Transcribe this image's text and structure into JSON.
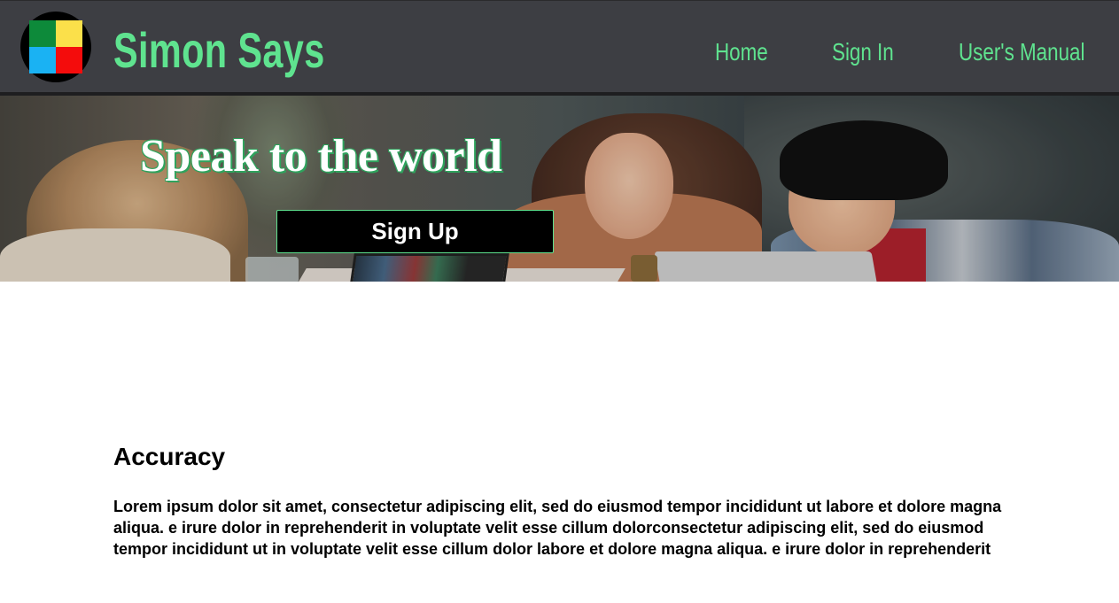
{
  "header": {
    "brand": "Simon Says",
    "logo_icon": "simon-says-logo-icon",
    "logo_colors": [
      "#0d8a3a",
      "#fbe04a",
      "#1ab2f3",
      "#f40c0c"
    ],
    "nav": [
      {
        "label": "Home"
      },
      {
        "label": "Sign In"
      },
      {
        "label": "User's Manual"
      }
    ],
    "accent_color": "#5fe38f",
    "background_color": "#3d3e43"
  },
  "hero": {
    "title": "Speak to the world",
    "cta_label": "Sign Up"
  },
  "section": {
    "title": "Accuracy",
    "body": "Lorem ipsum dolor sit amet, consectetur adipiscing elit, sed do eiusmod tempor incididunt ut labore et dolore magna aliqua. e irure dolor in reprehenderit in voluptate velit esse cillum dolorconsectetur adipiscing elit, sed do eiusmod tempor incididunt ut in voluptate velit esse cillum dolor labore et dolore magna aliqua. e irure dolor in reprehenderit"
  }
}
